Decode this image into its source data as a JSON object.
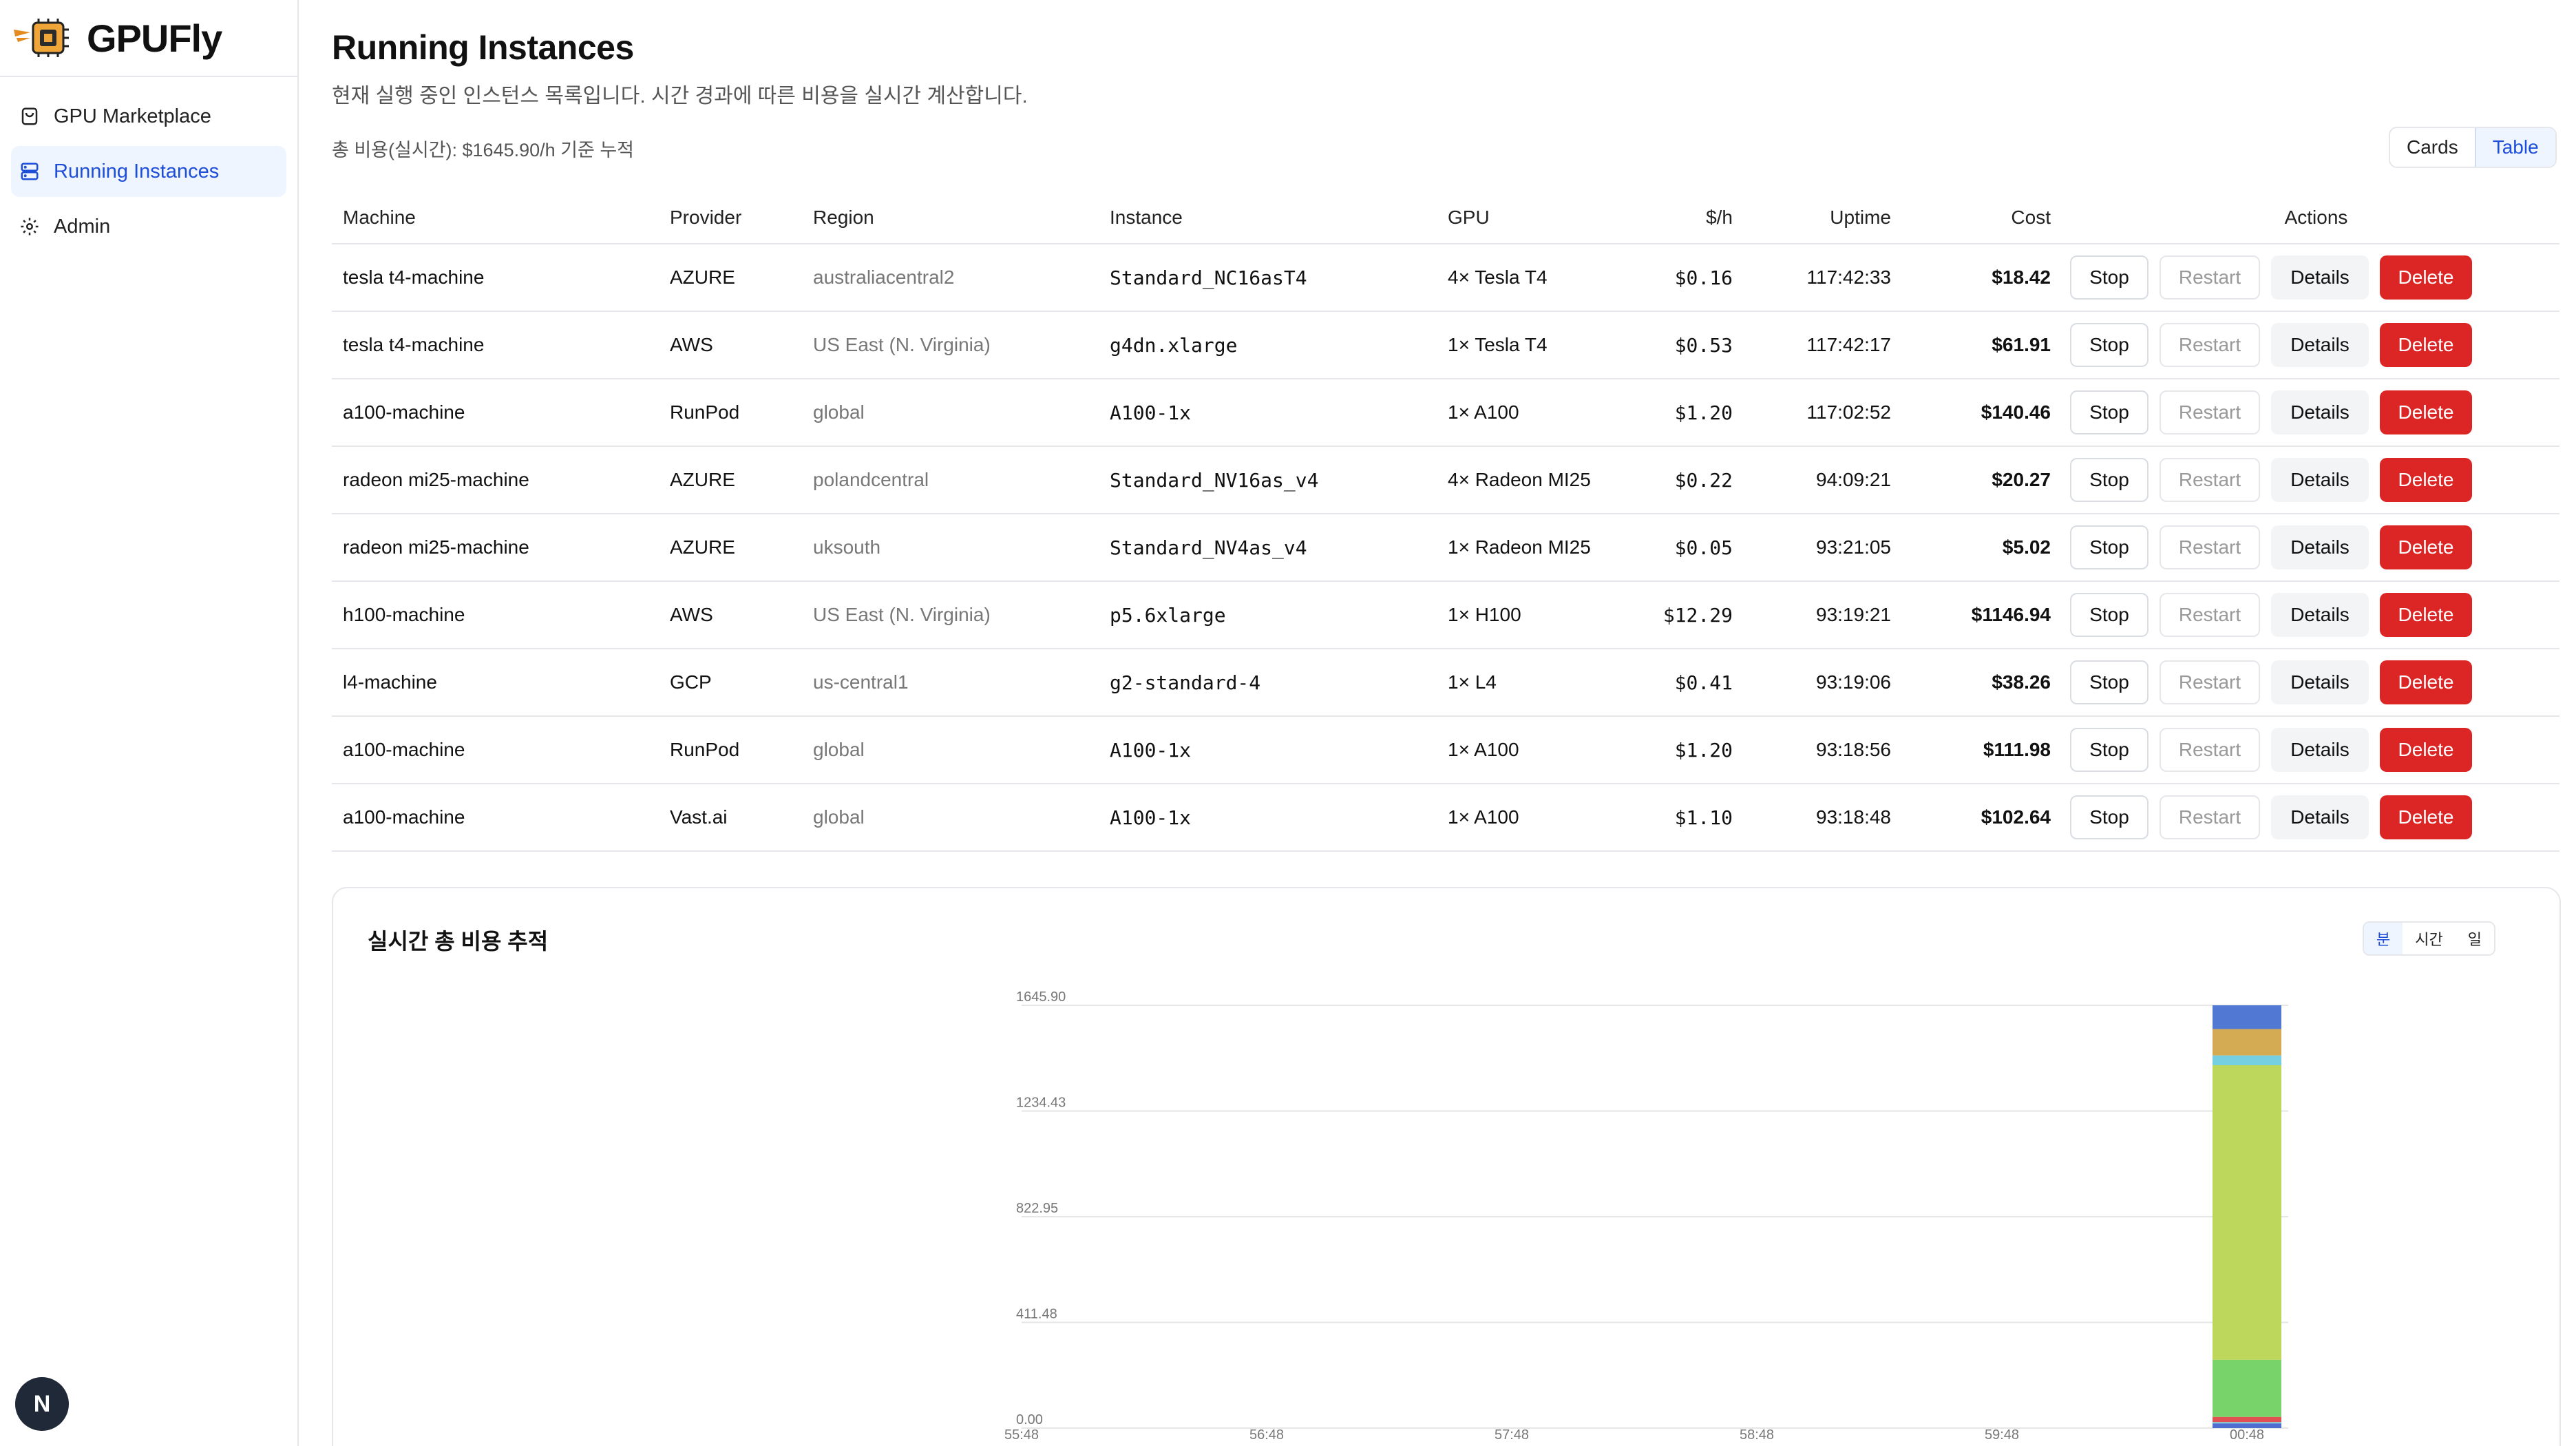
{
  "brand": {
    "name": "GPUFly"
  },
  "nav": {
    "items": [
      {
        "label": "GPU Marketplace",
        "icon": "cart-icon"
      },
      {
        "label": "Running Instances",
        "icon": "server-icon"
      },
      {
        "label": "Admin",
        "icon": "gear-icon"
      }
    ]
  },
  "user": {
    "avatar": "N"
  },
  "page": {
    "title": "Running Instances",
    "subtitle": "현재 실행 중인 인스턴스 목록입니다. 시간 경과에 따른 비용을 실시간 계산합니다.",
    "total": "총 비용(실시간): $1645.90/h 기준 누적",
    "view_toggle": {
      "cards": "Cards",
      "table": "Table",
      "selected": "Table"
    }
  },
  "table": {
    "headers": {
      "machine": "Machine",
      "provider": "Provider",
      "region": "Region",
      "instance": "Instance",
      "gpu": "GPU",
      "rate": "$/h",
      "uptime": "Uptime",
      "cost": "Cost",
      "actions": "Actions"
    },
    "actions": {
      "stop": "Stop",
      "restart": "Restart",
      "details": "Details",
      "delete": "Delete"
    },
    "rows": [
      {
        "machine": "tesla t4-machine",
        "provider": "AZURE",
        "region": "australiacentral2",
        "instance": "Standard_NC16asT4",
        "gpu": "4× Tesla T4",
        "rate": "$0.16",
        "uptime": "117:42:33",
        "cost": "$18.42"
      },
      {
        "machine": "tesla t4-machine",
        "provider": "AWS",
        "region": "US East (N. Virginia)",
        "instance": "g4dn.xlarge",
        "gpu": "1× Tesla T4",
        "rate": "$0.53",
        "uptime": "117:42:17",
        "cost": "$61.91"
      },
      {
        "machine": "a100-machine",
        "provider": "RunPod",
        "region": "global",
        "instance": "A100-1x",
        "gpu": "1× A100",
        "rate": "$1.20",
        "uptime": "117:02:52",
        "cost": "$140.46"
      },
      {
        "machine": "radeon mi25-machine",
        "provider": "AZURE",
        "region": "polandcentral",
        "instance": "Standard_NV16as_v4",
        "gpu": "4× Radeon MI25",
        "rate": "$0.22",
        "uptime": "94:09:21",
        "cost": "$20.27"
      },
      {
        "machine": "radeon mi25-machine",
        "provider": "AZURE",
        "region": "uksouth",
        "instance": "Standard_NV4as_v4",
        "gpu": "1× Radeon MI25",
        "rate": "$0.05",
        "uptime": "93:21:05",
        "cost": "$5.02"
      },
      {
        "machine": "h100-machine",
        "provider": "AWS",
        "region": "US East (N. Virginia)",
        "instance": "p5.6xlarge",
        "gpu": "1× H100",
        "rate": "$12.29",
        "uptime": "93:19:21",
        "cost": "$1146.94"
      },
      {
        "machine": "l4-machine",
        "provider": "GCP",
        "region": "us-central1",
        "instance": "g2-standard-4",
        "gpu": "1× L4",
        "rate": "$0.41",
        "uptime": "93:19:06",
        "cost": "$38.26"
      },
      {
        "machine": "a100-machine",
        "provider": "RunPod",
        "region": "global",
        "instance": "A100-1x",
        "gpu": "1× A100",
        "rate": "$1.20",
        "uptime": "93:18:56",
        "cost": "$111.98"
      },
      {
        "machine": "a100-machine",
        "provider": "Vast.ai",
        "region": "global",
        "instance": "A100-1x",
        "gpu": "1× A100",
        "rate": "$1.10",
        "uptime": "93:18:48",
        "cost": "$102.64"
      }
    ]
  },
  "chart": {
    "title": "실시간 총 비용 추적",
    "range": {
      "options": [
        "분",
        "시간",
        "일"
      ],
      "selected": "분"
    }
  },
  "chart_data": {
    "type": "bar",
    "stacked": true,
    "categories": [
      "55:48",
      "56:48",
      "57:48",
      "58:48",
      "59:48",
      "00:48"
    ],
    "yticks": [
      "0.00",
      "411.48",
      "822.95",
      "1234.43",
      "1645.90"
    ],
    "ylim": [
      0,
      1645.9
    ],
    "grid": true,
    "series": [
      {
        "values": [
          0,
          0,
          0,
          0,
          0,
          18.42
        ],
        "color": "#4f6fd0"
      },
      {
        "values": [
          0,
          0,
          0,
          0,
          0,
          5.02
        ],
        "color": "#7ed3df"
      },
      {
        "values": [
          0,
          0,
          0,
          0,
          0,
          20.27
        ],
        "color": "#e05252"
      },
      {
        "values": [
          0,
          0,
          0,
          0,
          0,
          222.0
        ],
        "color": "#77d36a"
      },
      {
        "values": [
          0,
          0,
          0,
          0,
          0,
          1146.94
        ],
        "color": "#bcd75b"
      },
      {
        "values": [
          0,
          0,
          0,
          0,
          0,
          38.26
        ],
        "color": "#75cfe0"
      },
      {
        "values": [
          0,
          0,
          0,
          0,
          0,
          102.64
        ],
        "color": "#d4ab52"
      },
      {
        "values": [
          0,
          0,
          0,
          0,
          0,
          92.35
        ],
        "color": "#5179d3"
      }
    ]
  }
}
